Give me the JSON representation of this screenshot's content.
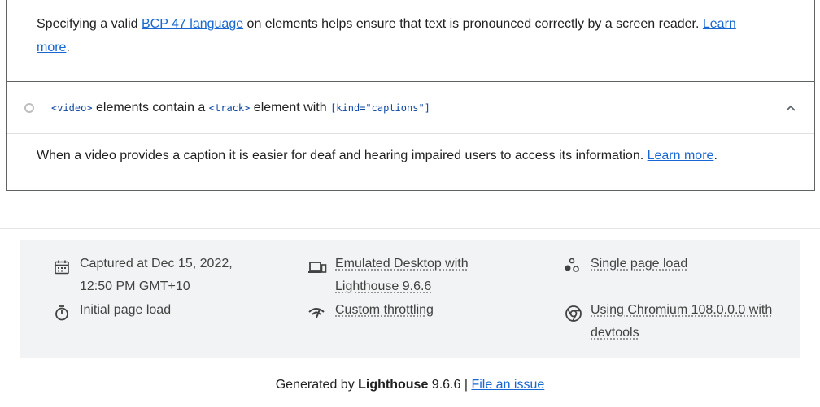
{
  "lang_audit": {
    "desc_before": "Specifying a valid ",
    "desc_link": "BCP 47 language",
    "desc_after": " on elements helps ensure that text is pronounced correctly by a screen reader. ",
    "learn_more_part1": "Learn",
    "learn_more_part2": "more",
    "period": "."
  },
  "video_audit": {
    "code1": "<video>",
    "text1": " elements contain a ",
    "code2": "<track>",
    "text2": " element with ",
    "code3": "[kind=\"captions\"]",
    "description": "When a video provides a caption it is easier for deaf and hearing impaired users to access its information. ",
    "learn_more": "Learn more",
    "period": "."
  },
  "footer": {
    "captured_line1": "Captured at Dec 15, 2022,",
    "captured_line2": "12:50 PM GMT+10",
    "initial_load": "Initial page load",
    "emulated_line1": "Emulated Desktop with",
    "emulated_line2": "Lighthouse 9.6.6",
    "throttling": "Custom throttling",
    "single_load": "Single page load",
    "chromium_line1": "Using Chromium 108.0.0.0 with",
    "chromium_line2": "devtools"
  },
  "generated": {
    "prefix": "Generated by ",
    "brand": "Lighthouse",
    "version": " 9.6.6 | ",
    "file_issue": "File an issue"
  },
  "icons": [
    "calendar-icon",
    "stopwatch-icon",
    "devices-icon",
    "throttling-icon",
    "single-load-icon",
    "chromium-icon",
    "status-circle-icon",
    "chevron-up-icon"
  ],
  "colors": {
    "link": "#1967d2",
    "code": "#0d47a1",
    "footer_bg": "#f1f3f4",
    "border": "#5f6368"
  }
}
